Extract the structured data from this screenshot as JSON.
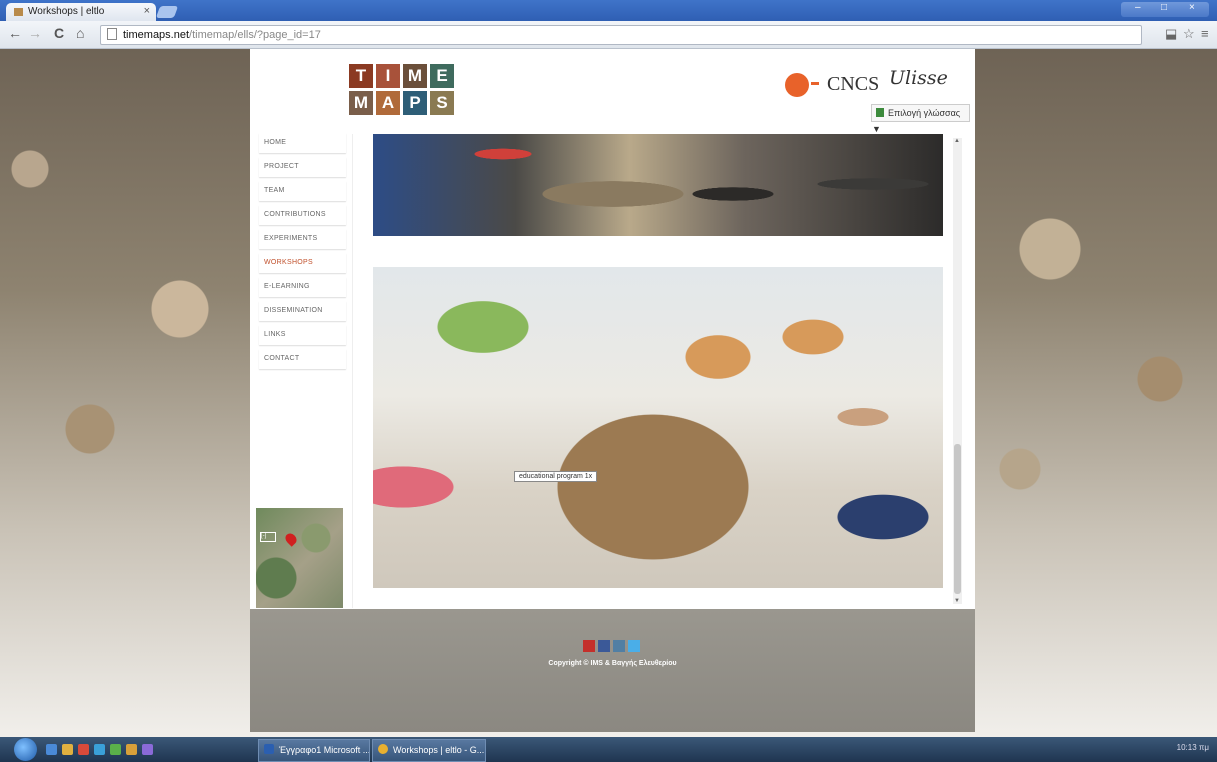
{
  "browser": {
    "tab_title": "Workshops | eltlo",
    "tab_close": "×",
    "url_domain": "timemaps.net",
    "url_path": "/timemap/ells/?page_id=17",
    "nav": {
      "back": "←",
      "forward": "→",
      "reload": "C",
      "home": "⌂"
    },
    "toolbar_right": {
      "extensions": "⬓",
      "bookmark": "☆",
      "menu": "≡"
    },
    "window_controls": {
      "minimize": "–",
      "maximize": "□",
      "close": "×"
    }
  },
  "site": {
    "logo_letters": [
      "T",
      "I",
      "M",
      "E",
      "M",
      "A",
      "P",
      "S"
    ],
    "partners": {
      "badge": "",
      "cncs": "CNCS",
      "script": "Ulisse"
    },
    "language_selector": "Επιλογή γλώσσας ▼",
    "nav_items": [
      {
        "label": "HOME",
        "active": false
      },
      {
        "label": "PROJECT",
        "active": false
      },
      {
        "label": "TEAM",
        "active": false
      },
      {
        "label": "CONTRIBUTIONS",
        "active": false
      },
      {
        "label": "EXPERIMENTS",
        "active": false
      },
      {
        "label": "WORKSHOPS",
        "active": true
      },
      {
        "label": "E-LEARNING",
        "active": false
      },
      {
        "label": "DISSEMINATION",
        "active": false
      },
      {
        "label": "LINKS",
        "active": false
      },
      {
        "label": "CONTACT",
        "active": false
      }
    ],
    "photo_caption": "educational program 1x",
    "scroll": {
      "up": "▲",
      "down": "▼"
    },
    "footer": {
      "copyright": "Copyright © IMS & Βαγγής Ελευθερίου",
      "social_icons": [
        "youtube-icon",
        "facebook-icon",
        "instagram-icon",
        "twitter-icon"
      ]
    },
    "map_zoom_label": "[-]"
  },
  "taskbar": {
    "tasks": [
      {
        "label": "Έγγραφο1 Microsoft ..."
      },
      {
        "label": "Workshops | eltlo - G..."
      }
    ],
    "clock": "10:13 πμ"
  },
  "colors": {
    "logo_tiles": [
      "#8b3a22",
      "#a8523a",
      "#6b4f3a",
      "#3f6b5e",
      "#7a5e4a",
      "#b06a3a",
      "#2e5e77",
      "#8a7a52"
    ],
    "active_nav": "#c0502c",
    "social": [
      "#c4302b",
      "#3b5998",
      "#517fa4",
      "#4aaee8"
    ]
  }
}
